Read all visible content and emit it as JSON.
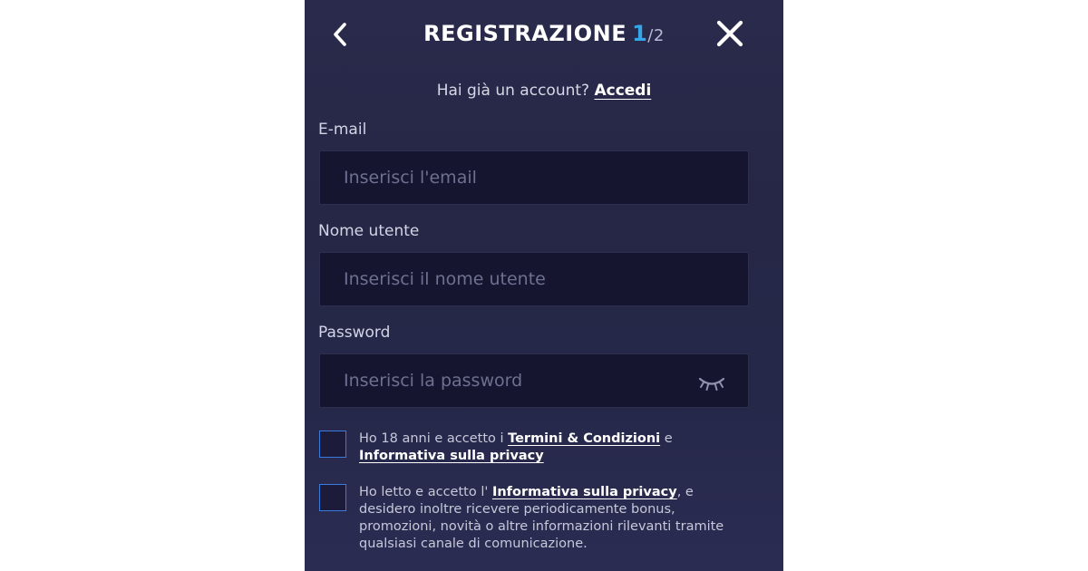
{
  "header": {
    "title": "REGISTRAZIONE",
    "step_current": "1",
    "step_total": "/2"
  },
  "login_prompt": {
    "text": "Hai già un account?",
    "link": "Accedi"
  },
  "fields": {
    "email": {
      "label": "E-mail",
      "placeholder": "Inserisci l'email"
    },
    "username": {
      "label": "Nome utente",
      "placeholder": "Inserisci il nome utente"
    },
    "password": {
      "label": "Password",
      "placeholder": "Inserisci la password"
    }
  },
  "consents": {
    "terms": {
      "text_before": "Ho 18 anni e accetto i ",
      "link_terms": "Termini & Condizioni",
      "text_middle": " e ",
      "link_privacy": "Informativa sulla privacy"
    },
    "marketing": {
      "text_before": "Ho letto e accetto l' ",
      "link_privacy": "Informativa sulla privacy",
      "text_after": ", e desidero inoltre ricevere periodicamente bonus, promozioni, novità o altre informazioni rilevanti tramite qualsiasi canale di comunicazione."
    }
  },
  "icons": {
    "back": "chevron-left-icon",
    "close": "close-icon",
    "password_toggle": "eye-closed-icon"
  },
  "colors": {
    "accent": "#35a6e8",
    "checkbox_border": "#3a7be0",
    "panel": "#26284a",
    "input_bg": "#151530"
  }
}
